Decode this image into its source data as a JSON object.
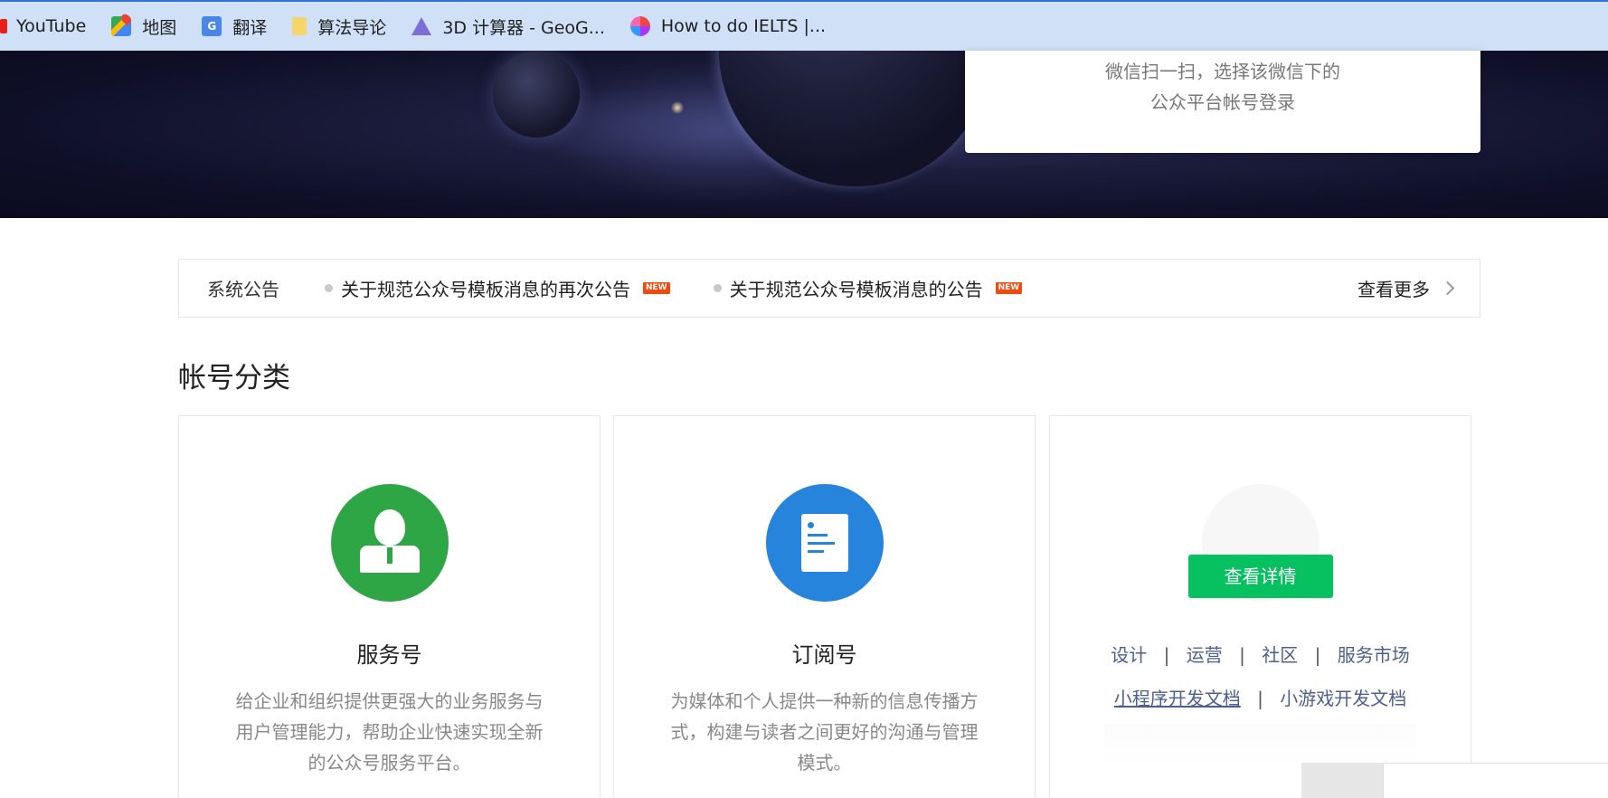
{
  "bookmarks": [
    {
      "label": "YouTube",
      "icon": "youtube-icon"
    },
    {
      "label": "地图",
      "icon": "maps-icon"
    },
    {
      "label": "翻译",
      "icon": "translate-icon"
    },
    {
      "label": "算法导论",
      "icon": "folder-icon"
    },
    {
      "label": "3D 计算器 - GeoG...",
      "icon": "geogebra-icon"
    },
    {
      "label": "How to do IELTS |...",
      "icon": "ielts-icon"
    }
  ],
  "login": {
    "line1": "微信扫一扫，选择该微信下的",
    "line2": "公众平台帐号登录"
  },
  "notice": {
    "label": "系统公告",
    "items": [
      {
        "text": "关于规范公众号模板消息的再次公告",
        "badge": "NEW"
      },
      {
        "text": "关于规范公众号模板消息的公告",
        "badge": "NEW"
      }
    ],
    "more": "查看更多"
  },
  "section": {
    "title": "帐号分类"
  },
  "cards": [
    {
      "title": "服务号",
      "desc": "给企业和组织提供更强大的业务服务与用户管理能力，帮助企业快速实现全新的公众号服务平台。"
    },
    {
      "title": "订阅号",
      "desc": "为媒体和个人提供一种新的信息传播方式，构建与读者之间更好的沟通与管理模式。"
    }
  ],
  "mini": {
    "button": "查看详情",
    "links1": [
      "设计",
      "运营",
      "社区",
      "服务市场"
    ],
    "links2": [
      "小程序开发文档",
      "小游戏开发文档"
    ],
    "separator": "|"
  },
  "colors": {
    "green": "#2ea645",
    "blue": "#2784dc",
    "wechat_green": "#07c160",
    "badge": "#f04a0c"
  }
}
